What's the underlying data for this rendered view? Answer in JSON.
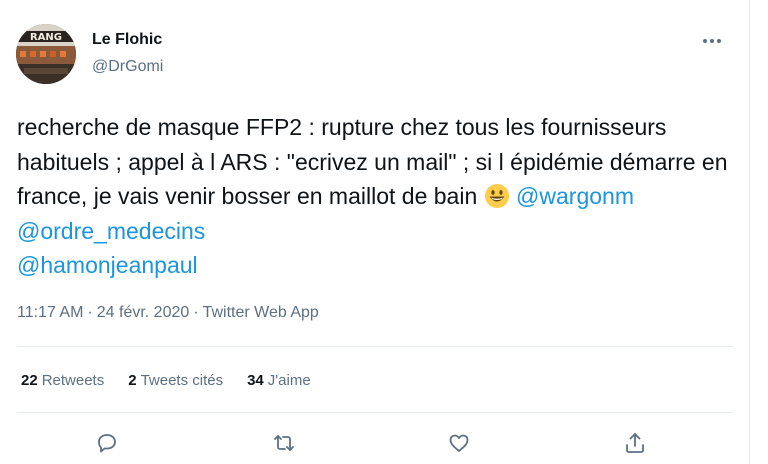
{
  "author": {
    "name": "Le Flohic",
    "handle": "@DrGomi"
  },
  "tweet": {
    "text_parts": {
      "line_text": "recherche de masque FFP2 : rupture chez tous les fournisseurs habituels ; appel à l ARS : \"ecrivez un mail\" ; si l épidémie démarre en france, je vais venir bosser en maillot de bain",
      "emoji": "smiling-face-icon",
      "mention_1": "@wargonm",
      "mention_2": "@ordre_medecins",
      "mention_3": "@hamonjeanpaul"
    },
    "time": "11:17 AM",
    "separator_1": "·",
    "date": "24 févr. 2020",
    "separator_2": "·",
    "source": "Twitter Web App"
  },
  "stats": {
    "retweets_count": "22",
    "retweets_label": "Retweets",
    "quotes_count": "2",
    "quotes_label": "Tweets cités",
    "likes_count": "34",
    "likes_label": "J'aime"
  },
  "colors": {
    "text": "#0f1419",
    "secondary": "#5b7083",
    "link": "#1b95e0",
    "divider": "#e6ecf0"
  },
  "icons": {
    "more": "more-icon",
    "reply": "reply-icon",
    "retweet": "retweet-icon",
    "like": "heart-icon",
    "share": "share-icon"
  }
}
